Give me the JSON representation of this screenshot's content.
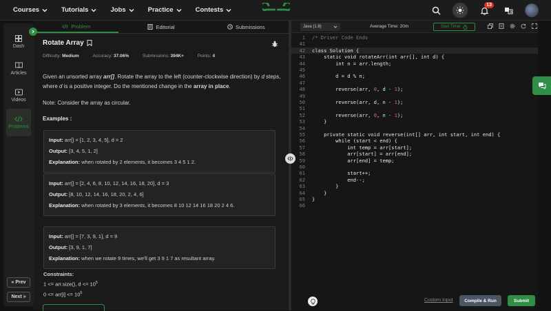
{
  "nav": {
    "items": [
      {
        "label": "Courses"
      },
      {
        "label": "Tutorials"
      },
      {
        "label": "Jobs"
      },
      {
        "label": "Practice"
      },
      {
        "label": "Contests"
      }
    ],
    "notification_count": "13"
  },
  "rail": {
    "items": [
      {
        "label": "Dash"
      },
      {
        "label": "Articles"
      },
      {
        "label": "Videos"
      },
      {
        "label": "Problems"
      }
    ],
    "prev_label": "« Prev",
    "next_label": "Next »"
  },
  "tabs": [
    {
      "label": "Problem"
    },
    {
      "label": "Editorial"
    },
    {
      "label": "Submissions"
    }
  ],
  "problem": {
    "title": "Rotate Array",
    "difficulty_label": "Difficulty:",
    "difficulty": "Medium",
    "accuracy_label": "Accuracy:",
    "accuracy": "37.06%",
    "submissions_label": "Submissions:",
    "submissions": "394K+",
    "points_label": "Points:",
    "points": "4",
    "desc_1": "Given an unsorted array ",
    "desc_arr": "arr[]",
    "desc_2": ". Rotate the array to the left (counter-clockwise direction) by ",
    "desc_d": "d",
    "desc_3": " steps, where ",
    "desc_d2": "d",
    "desc_4": " is a positive integer. Do the mentioned change in the ",
    "desc_bold": "array in place",
    "desc_5": ".",
    "note": "Note: Consider the array as circular.",
    "examples_label": "Examples :",
    "input_label": "Input:",
    "output_label": "Output:",
    "explanation_label": "Explanation:",
    "examples": [
      {
        "input": "arr[] = [1, 2, 3, 4, 5], d = 2",
        "output": "[3, 4, 5, 1, 2]",
        "explanation": "when rotated by 2 elements, it becomes 3 4 5 1 2."
      },
      {
        "input": "arr[] = [2, 4, 6, 8, 10, 12, 14, 16, 18, 20], d = 3",
        "output": "[8, 10, 12, 14, 16, 18, 20, 2, 4, 6]",
        "explanation": "when rotated by 3 elements, it becomes 8 10 12 14 16 18 20 2 4 6."
      },
      {
        "input": "arr[] = [7, 3, 9, 1], d = 9",
        "output": "[3, 9, 1, 7]",
        "explanation": "when we rotate 9 times, we'll get 3 9 1 7 as resultant array."
      }
    ],
    "constraints_label": "Constraints:",
    "c1_base": "1 <= arr.size(), d <= 10",
    "c1_exp": "5",
    "c2_base": "0 <= arr[i] <= 10",
    "c2_exp": "5"
  },
  "editor": {
    "language": "Java (1.8)",
    "avg_time": "Average Time: 20m",
    "timer_label": "Start Timer",
    "lines": [
      {
        "n": "1",
        "t": "/* Driver Code Ends"
      },
      {
        "n": "41",
        "t": ""
      },
      {
        "n": "42",
        "t": "class Solution {"
      },
      {
        "n": "43",
        "t": "    static void rotateArr(int arr[], int d) {"
      },
      {
        "n": "44",
        "t": "        int n = arr.length;"
      },
      {
        "n": "45",
        "t": ""
      },
      {
        "n": "46",
        "t": "        d = d % n;"
      },
      {
        "n": "47",
        "t": ""
      },
      {
        "n": "48",
        "t": "        reverse(arr, 0, d - 1);"
      },
      {
        "n": "49",
        "t": ""
      },
      {
        "n": "50",
        "t": "        reverse(arr, d, n - 1);"
      },
      {
        "n": "51",
        "t": ""
      },
      {
        "n": "52",
        "t": "        reverse(arr, 0, n - 1);"
      },
      {
        "n": "53",
        "t": "    }"
      },
      {
        "n": "54",
        "t": ""
      },
      {
        "n": "55",
        "t": "    private static void reverse(int[] arr, int start, int end) {"
      },
      {
        "n": "56",
        "t": "        while (start < end) {"
      },
      {
        "n": "57",
        "t": "            int temp = arr[start];"
      },
      {
        "n": "58",
        "t": "            arr[start] = arr[end];"
      },
      {
        "n": "59",
        "t": "            arr[end] = temp;"
      },
      {
        "n": "60",
        "t": ""
      },
      {
        "n": "61",
        "t": "            start++;"
      },
      {
        "n": "62",
        "t": "            end--;"
      },
      {
        "n": "63",
        "t": "        }"
      },
      {
        "n": "64",
        "t": "    }"
      },
      {
        "n": "65",
        "t": "}"
      },
      {
        "n": "66",
        "t": ""
      }
    ],
    "custom_input": "Custom Input",
    "compile_label": "Compile & Run",
    "submit_label": "Submit"
  }
}
